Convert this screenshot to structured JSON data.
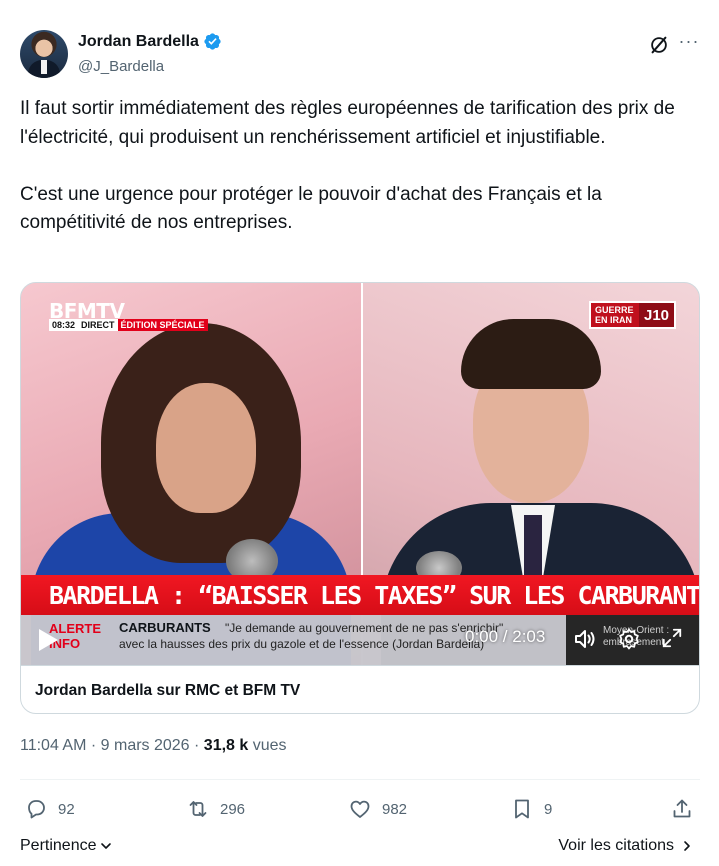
{
  "author": {
    "display_name": "Jordan Bardella",
    "handle": "@J_Bardella",
    "verified": true
  },
  "tweet": {
    "paragraphs": [
      "Il faut sortir immédiatement des règles européennes de tarification des prix de l'électricité, qui produisent un renchérissement artificiel et injustifiable.",
      "C'est une urgence pour protéger le pouvoir d'achat des Français et la compétitivité de nos entreprises."
    ]
  },
  "media": {
    "channel_logo": "BFMTV",
    "broadcast_time": "08:32",
    "broadcast_live": "DIRECT",
    "broadcast_special": "ÉDITION SPÉCIALE",
    "badge_text": "GUERRE EN IRAN",
    "badge_day": "J10",
    "headline": "BARDELLA : “BAISSER LES TAXES” SUR LES CARBURANTS",
    "alert_label": "ALERTE INFO",
    "ticker_topic": "CARBURANTS",
    "ticker_quote": "\"Je demande au gouvernement de ne pas s'enrichir\"",
    "ticker_line2": "avec la hausses des prix du gazole et de l'essence (Jordan Bardella)",
    "ticker_side": "Moyen-Orient : embrasement",
    "timecode": "0:00 / 2:03",
    "card_title": "Jordan Bardella sur RMC et BFM TV"
  },
  "meta": {
    "time": "11:04 AM",
    "separator": " · ",
    "date": "9 mars 2026",
    "views_count": "31,8 k",
    "views_label": " vues"
  },
  "actions": {
    "replies": "92",
    "retweets": "296",
    "likes": "982",
    "bookmarks": "9"
  },
  "footer": {
    "sort_label": "Pertinence",
    "quotes_link": "Voir les citations"
  },
  "colors": {
    "text_primary": "#0f1419",
    "text_secondary": "#536471",
    "verified_blue": "#1d9bf0",
    "bfm_red": "#e2001a",
    "border": "#cfd9de"
  },
  "icons": {
    "verified": "verified-badge-icon",
    "grok": "grok-icon",
    "more": "more-icon",
    "play": "play-icon",
    "volume": "volume-icon",
    "settings": "settings-icon",
    "fullscreen": "fullscreen-icon",
    "reply": "reply-icon",
    "retweet": "retweet-icon",
    "like": "heart-icon",
    "bookmark": "bookmark-icon",
    "share": "share-icon"
  }
}
